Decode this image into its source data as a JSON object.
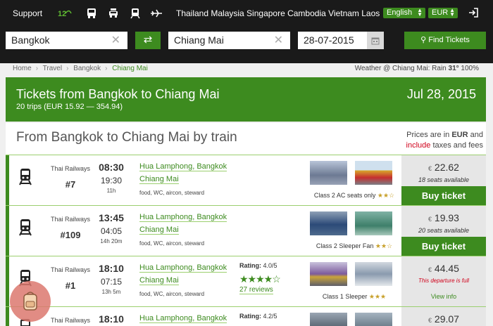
{
  "header": {
    "support_label": "Support",
    "transport_icons": [
      "12go-logo-icon",
      "bus-icon",
      "car-icon",
      "train-icon",
      "plane-icon"
    ],
    "countries": "Thailand Malaysia Singapore Cambodia Vietnam Laos",
    "language": "English",
    "currency": "EUR",
    "login_icon": "login-icon"
  },
  "search": {
    "from": "Bangkok",
    "to": "Chiang Mai",
    "date": "28-07-2015",
    "find_label": "Find Tickets"
  },
  "breadcrumb": [
    "Home",
    "Travel",
    "Bangkok",
    "Chiang Mai"
  ],
  "weather": {
    "prefix": "Weather @ Chiang Mai: Rain",
    "temp": "31°",
    "humidity": "100%"
  },
  "banner": {
    "title": "Tickets from Bangkok to Chiang Mai",
    "subtitle": "20 trips (EUR 15.92 — 354.94)",
    "date": "Jul 28, 2015"
  },
  "section": {
    "title": "From Bangkok to Chiang Mai by train",
    "note_prefix": "Prices are in",
    "note_currency": "EUR",
    "note_and": "and",
    "note_include": "include",
    "note_suffix": "taxes and fees"
  },
  "trips": [
    {
      "operator": "Thai Railways",
      "number": "#7",
      "depart": "08:30",
      "arrive": "19:30",
      "duration": "11h",
      "from": "Hua Lamphong, Bangkok",
      "to": "Chiang Mai",
      "facilities": "food, WC, aircon, steward",
      "rating_label": "",
      "rating": "",
      "stars": "",
      "reviews": "",
      "class": "Class 2 AC seats only",
      "class_stars": "★★☆",
      "currency_symbol": "€",
      "price": "22.62",
      "availability": "18 seats available",
      "action": "Buy ticket"
    },
    {
      "operator": "Thai Railways",
      "number": "#109",
      "depart": "13:45",
      "arrive": "04:05",
      "duration": "14h 20m",
      "from": "Hua Lamphong, Bangkok",
      "to": "Chiang Mai",
      "facilities": "food, WC, aircon, steward",
      "rating_label": "",
      "rating": "",
      "stars": "",
      "reviews": "",
      "class": "Class 2 Sleeper Fan",
      "class_stars": "★★☆",
      "currency_symbol": "€",
      "price": "19.93",
      "availability": "20 seats available",
      "action": "Buy ticket"
    },
    {
      "operator": "Thai Railways",
      "number": "#1",
      "depart": "18:10",
      "arrive": "07:15",
      "duration": "13h 5m",
      "from": "Hua Lamphong, Bangkok",
      "to": "Chiang Mai",
      "facilities": "food, WC, aircon, steward",
      "rating_label": "Rating:",
      "rating": "4.0/5",
      "stars": "★★★★☆",
      "reviews": "27 reviews",
      "class": "Class 1 Sleeper",
      "class_stars": "★★★",
      "currency_symbol": "€",
      "price": "44.45",
      "availability": "This departure is full",
      "action": "View info"
    },
    {
      "operator": "Thai Railways",
      "number": "",
      "depart": "18:10",
      "arrive": "",
      "duration": "",
      "from": "Hua Lamphong, Bangkok",
      "to": "",
      "facilities": "",
      "rating_label": "Rating:",
      "rating": "4.2/5",
      "stars": "",
      "reviews": "",
      "class": "",
      "class_stars": "",
      "currency_symbol": "€",
      "price": "29.07",
      "availability": "",
      "action": ""
    }
  ],
  "colors": {
    "accent": "#3d8b1f",
    "topbar": "#1a1a1a",
    "alert": "#d0021b"
  }
}
